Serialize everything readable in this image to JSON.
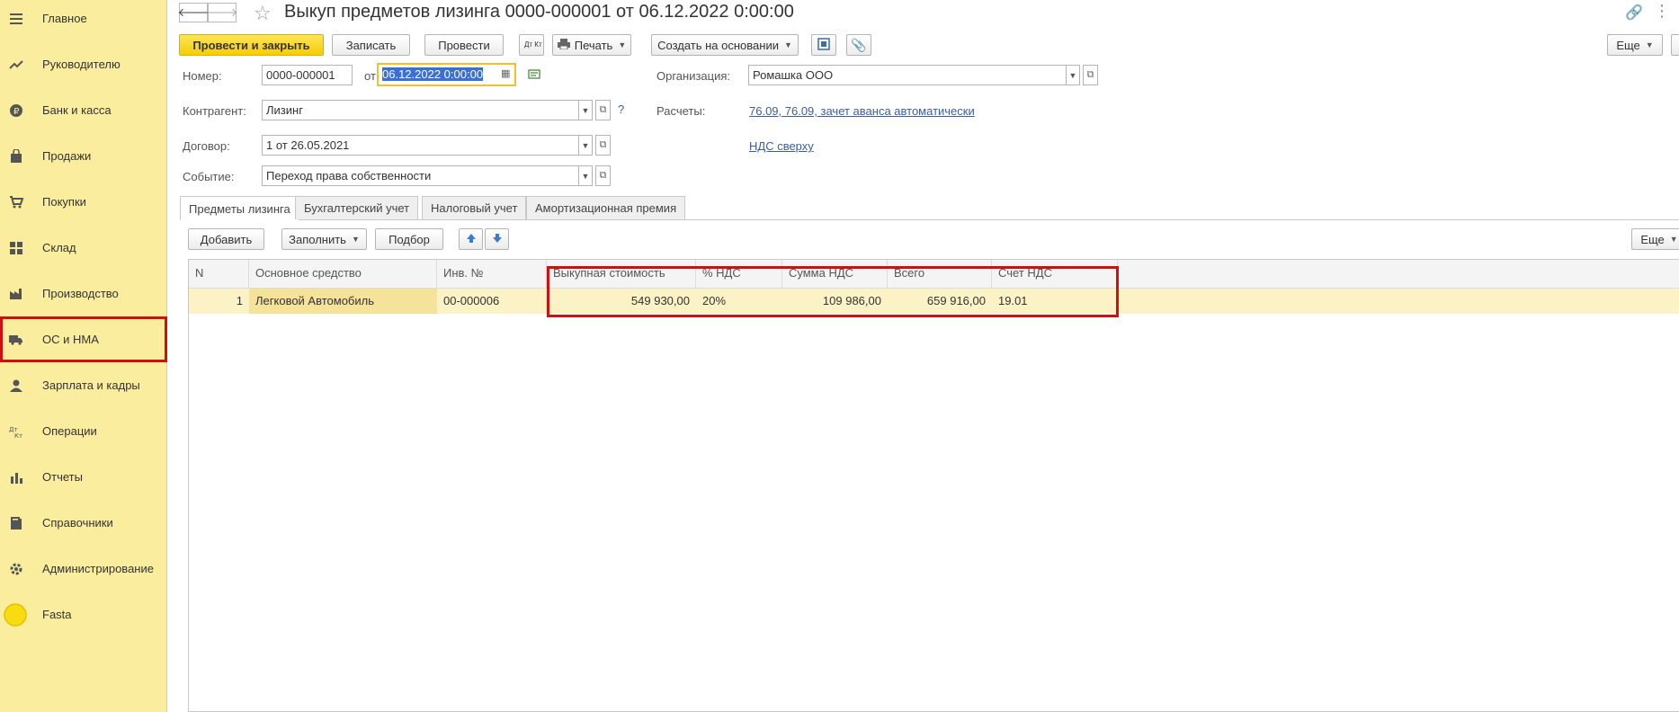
{
  "sidebar": {
    "items": [
      {
        "label": "Главное",
        "icon": "menu-icon"
      },
      {
        "label": "Руководителю",
        "icon": "trend-icon"
      },
      {
        "label": "Банк и касса",
        "icon": "coin-icon"
      },
      {
        "label": "Продажи",
        "icon": "bag-icon"
      },
      {
        "label": "Покупки",
        "icon": "cart-icon"
      },
      {
        "label": "Склад",
        "icon": "grid-icon"
      },
      {
        "label": "Производство",
        "icon": "factory-icon"
      },
      {
        "label": "ОС и НМА",
        "icon": "truck-icon"
      },
      {
        "label": "Зарплата и кадры",
        "icon": "person-icon"
      },
      {
        "label": "Операции",
        "icon": "dt-kt-icon"
      },
      {
        "label": "Отчеты",
        "icon": "bar-chart-icon"
      },
      {
        "label": "Справочники",
        "icon": "book-icon"
      },
      {
        "label": "Администрирование",
        "icon": "gear-icon"
      },
      {
        "label": "Fasta",
        "icon": "circle-icon"
      }
    ],
    "highlight_color": "#d20f0f",
    "background": "#fbed9e"
  },
  "header": {
    "title": "Выкуп предметов лизинга 0000-000001 от 06.12.2022 0:00:00"
  },
  "toolbar": {
    "post_close": "Провести и закрыть",
    "save": "Записать",
    "post": "Провести",
    "dt_kt": "Дт Кт",
    "print": "Печать",
    "create_based": "Создать на основании",
    "more": "Еще"
  },
  "form": {
    "number_label": "Номер:",
    "number_value": "0000-000001",
    "date_label": "от:",
    "date_value": "06.12.2022  0:00:00",
    "org_label": "Организация:",
    "org_value": "Ромашка ООО",
    "contractor_label": "Контрагент:",
    "contractor_value": "Лизинг",
    "help": "?",
    "settlements_label": "Расчеты:",
    "settlements_link": "76.09, 76.09, зачет аванса автоматически",
    "contract_label": "Договор:",
    "contract_value": "1 от 26.05.2021",
    "vat_link": "НДС сверху",
    "event_label": "Событие:",
    "event_value": "Переход права собственности"
  },
  "tabs": [
    "Предметы лизинга",
    "Бухгалтерский учет",
    "Налоговый учет",
    "Амортизационная премия"
  ],
  "table_toolbar": {
    "add": "Добавить",
    "fill": "Заполнить",
    "select": "Подбор",
    "more": "Еще"
  },
  "table": {
    "columns": [
      "N",
      "Основное средство",
      "Инв. №",
      "Выкупная стоимость",
      "% НДС",
      "Сумма НДС",
      "Всего",
      "Счет НДС"
    ],
    "rows": [
      [
        "1",
        "Легковой Автомобиль",
        "00-000006",
        "549 930,00",
        "20%",
        "109 986,00",
        "659 916,00",
        "19.01"
      ]
    ]
  }
}
